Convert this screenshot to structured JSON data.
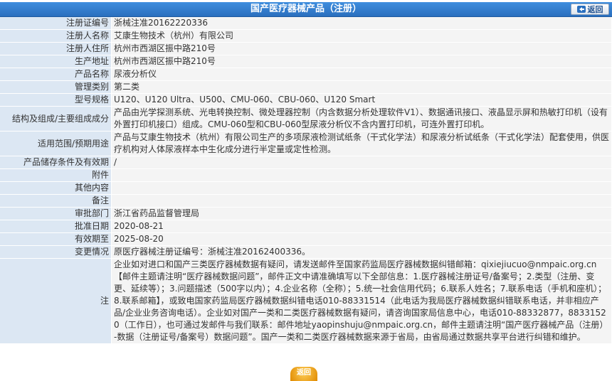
{
  "header": {
    "title": "国产医疗器械产品（注册）",
    "back_label": "返回"
  },
  "rows": [
    {
      "label": "注册证编号",
      "value": "浙械注准20162220336"
    },
    {
      "label": "注册人名称",
      "value": "艾康生物技术（杭州）有限公司"
    },
    {
      "label": "注册人住所",
      "value": "杭州市西湖区振中路210号"
    },
    {
      "label": "生产地址",
      "value": "杭州市西湖区振中路210号"
    },
    {
      "label": "产品名称",
      "value": "尿液分析仪"
    },
    {
      "label": "管理类别",
      "value": "第二类"
    },
    {
      "label": "型号规格",
      "value": "U120、U120 Ultra、U500、CMU-060、CBU-060、U120 Smart"
    },
    {
      "label": "结构及组成/主要组成成分",
      "value": "产品由光学探测系统、光电转换控制、微处理器控制（内含数据分析处理软件V1）、数据通讯接口、液晶显示屏和热敏打印机（设有外置打印机接口）组成。CMU-060型和CBU-060型尿液分析仪不含内置打印机，可连外置打印机。"
    },
    {
      "label": "适用范围/预期用途",
      "value": "产品与艾康生物技术（杭州）有限公司生产的多项尿液检测试纸条（干式化学法）和尿液分析试纸条（干式化学法）配套使用，供医疗机构对人体尿液样本中生化成分进行半定量或定性检测。"
    },
    {
      "label": "产品储存条件及有效期",
      "value": "/"
    },
    {
      "label": "附件",
      "value": ""
    },
    {
      "label": "其他内容",
      "value": ""
    },
    {
      "label": "备注",
      "value": ""
    },
    {
      "label": "审批部门",
      "value": "浙江省药品监督管理局"
    },
    {
      "label": "批准日期",
      "value": "2020-08-21"
    },
    {
      "label": "有效期至",
      "value": "2025-08-20"
    },
    {
      "label": "变更情况",
      "value": "原医疗器械注册证编号：浙械注准20162400336。"
    },
    {
      "label": "注",
      "value": "企业如对进口和国产三类医疗器械数据有疑问，请发送邮件至国家药监局医疗器械数据纠错邮箱：qixiejiucuo@nmpaic.org.cn【邮件主题请注明“医疗器械数据问题”，邮件正文中请准确填写以下全部信息：1.医疗器械注册证号/备案号；2.类型（注册、变更、延续等）；3.问题描述（500字以内）；4.企业名称（全称）；5.统一社会信用代码；6.联系人姓名；7.联系电话（手机和座机）；8.联系邮箱】，或致电国家药监局医疗器械数据纠错电话010-88331514（此电话为我局医疗器械数据纠错联系电话，并非相应产品/企业业务咨询电话）。企业如对国产一类和二类医疗器械数据有疑问，请咨询国家局信息中心，电话010-88332877，88331520（工作日），也可通过发邮件与我们联系：邮件地址yaopinshuju@nmpaic.org.cn，邮件主题请注明“国产医疗器械产品（注册）-数据（注册证号/备案号）数据问题”。国产一类和二类医疗器械数据来源于省局，由省局通过数据共享平台进行纠错和维护。"
    }
  ],
  "footer": {
    "back_label": "返回"
  }
}
